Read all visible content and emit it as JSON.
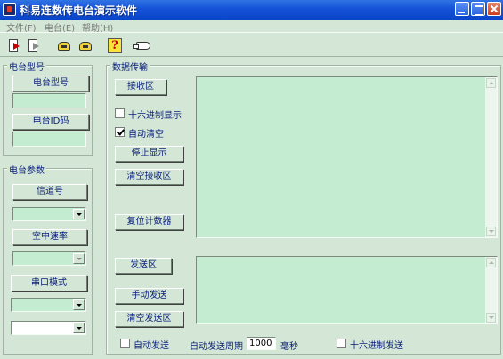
{
  "window": {
    "title": "科易连数传电台演示软件"
  },
  "menu": {
    "file": "文件(F)",
    "radio": "电台(E)",
    "help": "帮助(H)"
  },
  "toolbar": {
    "icons": [
      "open-file-icon",
      "save-file-icon",
      "connect-phone-icon",
      "disconnect-phone-icon",
      "help-icon",
      "pointing-hand-icon"
    ]
  },
  "model_group": {
    "title": "电台型号",
    "model_button": "电台型号",
    "model_value": "",
    "id_button": "电台ID码",
    "id_value": ""
  },
  "params_group": {
    "title": "电台参数",
    "channel_button": "信道号",
    "channel_value": "",
    "air_rate_button": "空中速率",
    "air_rate_value": "",
    "serial_mode_button": "串口模式",
    "serial_mode_value": "",
    "extra_select_value": ""
  },
  "data_group": {
    "title": "数据传输",
    "receive_area_button": "接收区",
    "receive_text": "",
    "hex_display_label": "十六进制显示",
    "hex_display_checked": false,
    "auto_clear_label": "自动清空",
    "auto_clear_checked": true,
    "stop_display_button": "停止显示",
    "clear_receive_button": "清空接收区",
    "reset_counter_button": "复位计数器",
    "send_area_button": "发送区",
    "send_text": "",
    "manual_send_button": "手动发送",
    "clear_send_button": "清空发送区",
    "auto_send_label": "自动发送",
    "auto_send_checked": false,
    "auto_send_period_label": "自动发送周期",
    "auto_send_period_value": "1000",
    "ms_label": "毫秒",
    "hex_send_label": "十六进制发送",
    "hex_send_checked": false
  }
}
